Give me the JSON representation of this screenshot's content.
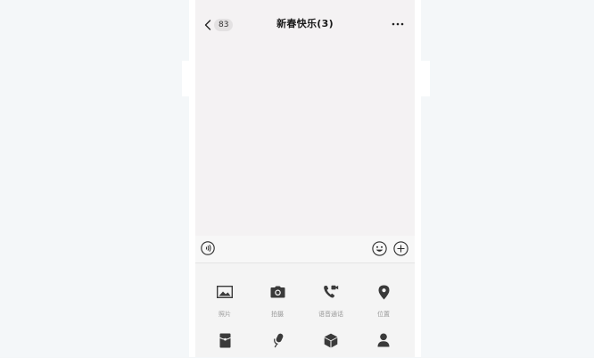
{
  "header": {
    "back_count": "83",
    "title": "新春快乐(3)"
  },
  "input_bar": {
    "value": "",
    "placeholder": ""
  },
  "tools": [
    {
      "label": "照片",
      "icon": "image-icon"
    },
    {
      "label": "拍摄",
      "icon": "camera-icon"
    },
    {
      "label": "语音通话",
      "icon": "phone-video-icon"
    },
    {
      "label": "位置",
      "icon": "location-pin-icon"
    },
    {
      "label": "",
      "icon": "red-packet-icon"
    },
    {
      "label": "",
      "icon": "microphone-icon"
    },
    {
      "label": "",
      "icon": "cube-icon"
    },
    {
      "label": "",
      "icon": "person-icon"
    }
  ],
  "colors": {
    "icon": "#3a3a3a",
    "screen_bg": "#f4f2f3",
    "page_bg": "#f3f6f8"
  }
}
